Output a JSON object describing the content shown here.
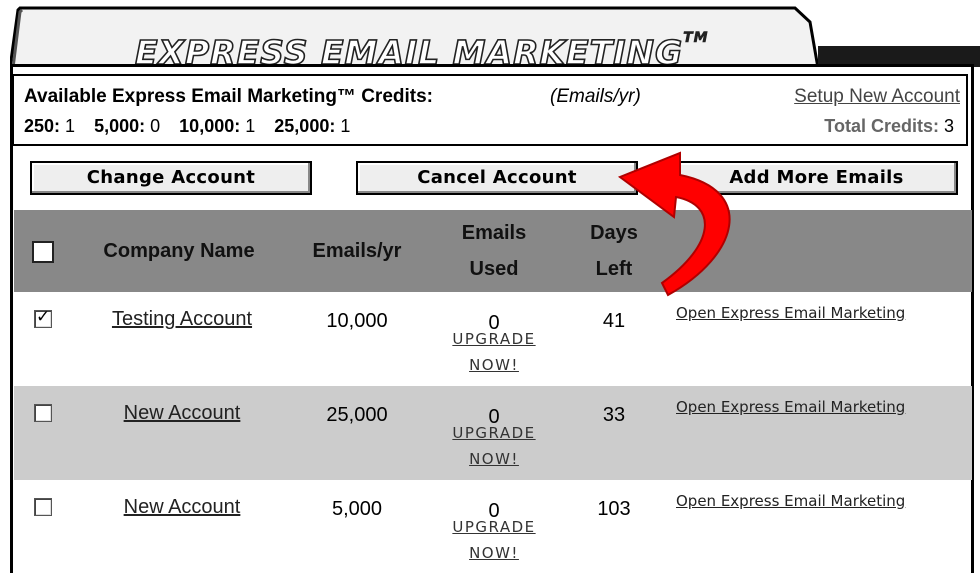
{
  "app": {
    "title": "EXPRESS EMAIL MARKETING",
    "trademark": "TM"
  },
  "credits": {
    "title": "Available Express Email Marketing™ Credits:",
    "unit": "(Emails/yr)",
    "setup_link": "Setup New Account",
    "tiers": [
      {
        "label": "250:",
        "value": "1"
      },
      {
        "label": "5,000:",
        "value": "0"
      },
      {
        "label": "10,000:",
        "value": "1"
      },
      {
        "label": "25,000:",
        "value": "1"
      }
    ],
    "total_label": "Total Credits:",
    "total_value": "3"
  },
  "toolbar": {
    "change_label": "Change Account",
    "cancel_label": "Cancel Account",
    "add_label": "Add More Emails"
  },
  "table": {
    "headers": {
      "company": "Company Name",
      "emails": "Emails/yr",
      "used_1": "Emails",
      "used_2": "Used",
      "days_1": "Days",
      "days_2": "Left"
    },
    "rows": [
      {
        "checked": true,
        "company": "Testing Account",
        "emails": "10,000",
        "used": "0",
        "upgrade_1": "UPGRADE",
        "upgrade_2": "NOW!",
        "days": "41",
        "open": "Open Express Email Marketing"
      },
      {
        "checked": false,
        "company": "New Account",
        "emails": "25,000",
        "used": "0",
        "upgrade_1": "UPGRADE",
        "upgrade_2": "NOW!",
        "days": "33",
        "open": "Open Express Email Marketing"
      },
      {
        "checked": false,
        "company": "New Account",
        "emails": "5,000",
        "used": "0",
        "upgrade_1": "UPGRADE",
        "upgrade_2": "NOW!",
        "days": "103",
        "open": "Open Express Email Marketing"
      }
    ]
  },
  "colors": {
    "header_bg": "#888888",
    "alt_row": "#cccccc",
    "annotation_arrow": "#ff0000"
  }
}
